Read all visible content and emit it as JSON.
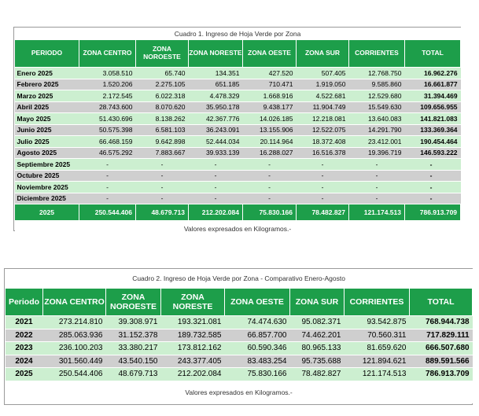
{
  "table1": {
    "caption": "Cuadro 1. Ingreso de Hoja Verde por Zona",
    "headers": [
      "PERIODO",
      "ZONA CENTRO",
      "ZONA NOROESTE",
      "ZONA NORESTE",
      "ZONA OESTE",
      "ZONA SUR",
      "CORRIENTES",
      "TOTAL"
    ],
    "rows": [
      [
        "Enero 2025",
        "3.058.510",
        "65.740",
        "134.351",
        "427.520",
        "507.405",
        "12.768.750",
        "16.962.276"
      ],
      [
        "Febrero 2025",
        "1.520.206",
        "2.275.105",
        "651.185",
        "710.471",
        "1.919.050",
        "9.585.860",
        "16.661.877"
      ],
      [
        "Marzo 2025",
        "2.172.545",
        "6.022.318",
        "4.478.329",
        "1.668.916",
        "4.522.681",
        "12.529.680",
        "31.394.469"
      ],
      [
        "Abril 2025",
        "28.743.600",
        "8.070.620",
        "35.950.178",
        "9.438.177",
        "11.904.749",
        "15.549.630",
        "109.656.955"
      ],
      [
        "Mayo 2025",
        "51.430.696",
        "8.138.262",
        "42.367.776",
        "14.026.185",
        "12.218.081",
        "13.640.083",
        "141.821.083"
      ],
      [
        "Junio 2025",
        "50.575.398",
        "6.581.103",
        "36.243.091",
        "13.155.906",
        "12.522.075",
        "14.291.790",
        "133.369.364"
      ],
      [
        "Julio 2025",
        "66.468.159",
        "9.642.898",
        "52.444.034",
        "20.114.964",
        "18.372.408",
        "23.412.001",
        "190.454.464"
      ],
      [
        "Agosto 2025",
        "46.575.292",
        "7.883.667",
        "39.933.139",
        "16.288.027",
        "16.516.378",
        "19.396.719",
        "146.593.222"
      ],
      [
        "Septiembre 2025",
        "-",
        "-",
        "-",
        "-",
        "-",
        "-",
        "-"
      ],
      [
        "Octubre 2025",
        "-",
        "-",
        "-",
        "-",
        "-",
        "-",
        "-"
      ],
      [
        "Noviembre 2025",
        "-",
        "-",
        "-",
        "-",
        "-",
        "-",
        "-"
      ],
      [
        "Diciembre 2025",
        "-",
        "-",
        "-",
        "-",
        "-",
        "-",
        "-"
      ]
    ],
    "total": [
      "2025",
      "250.544.406",
      "48.679.713",
      "212.202.084",
      "75.830.166",
      "78.482.827",
      "121.174.513",
      "786.913.709"
    ],
    "note": "Valores expresados en Kilogramos.-"
  },
  "table2": {
    "caption": "Cuadro 2. Ingreso de Hoja Verde por Zona - Comparativo Enero-Agosto",
    "headers": [
      "Periodo",
      "ZONA CENTRO",
      "ZONA NOROESTE",
      "ZONA NORESTE",
      "ZONA OESTE",
      "ZONA SUR",
      "CORRIENTES",
      "TOTAL"
    ],
    "rows": [
      [
        "2021",
        "273.214.810",
        "39.308.971",
        "193.321.081",
        "74.474.630",
        "95.082.371",
        "93.542.875",
        "768.944.738"
      ],
      [
        "2022",
        "285.063.936",
        "31.152.378",
        "189.732.585",
        "66.857.700",
        "74.462.201",
        "70.560.311",
        "717.829.111"
      ],
      [
        "2023",
        "236.100.203",
        "33.380.217",
        "173.812.162",
        "60.590.346",
        "80.965.133",
        "81.659.620",
        "666.507.680"
      ],
      [
        "2024",
        "301.560.449",
        "43.540.150",
        "243.377.405",
        "83.483.254",
        "95.735.688",
        "121.894.621",
        "889.591.566"
      ],
      [
        "2025",
        "250.544.406",
        "48.679.713",
        "212.202.084",
        "75.830.166",
        "78.482.827",
        "121.174.513",
        "786.913.709"
      ]
    ],
    "note": "Valores expresados en Kilogramos.-"
  },
  "colors": {
    "header_green": "#1d9e4a",
    "row_green": "#ccefd0",
    "row_gray": "#cfcfcf"
  }
}
